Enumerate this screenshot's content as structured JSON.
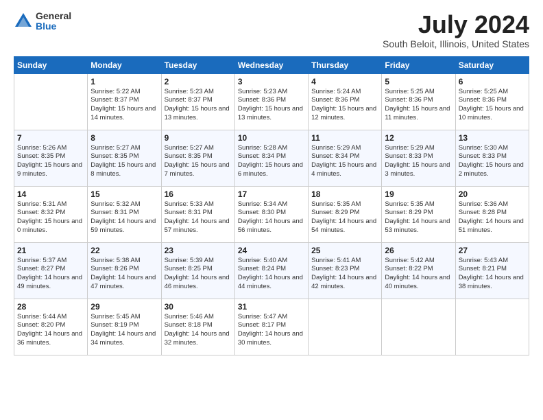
{
  "logo": {
    "general": "General",
    "blue": "Blue"
  },
  "title": "July 2024",
  "subtitle": "South Beloit, Illinois, United States",
  "days_header": [
    "Sunday",
    "Monday",
    "Tuesday",
    "Wednesday",
    "Thursday",
    "Friday",
    "Saturday"
  ],
  "weeks": [
    [
      {
        "num": "",
        "sunrise": "",
        "sunset": "",
        "daylight": ""
      },
      {
        "num": "1",
        "sunrise": "Sunrise: 5:22 AM",
        "sunset": "Sunset: 8:37 PM",
        "daylight": "Daylight: 15 hours and 14 minutes."
      },
      {
        "num": "2",
        "sunrise": "Sunrise: 5:23 AM",
        "sunset": "Sunset: 8:37 PM",
        "daylight": "Daylight: 15 hours and 13 minutes."
      },
      {
        "num": "3",
        "sunrise": "Sunrise: 5:23 AM",
        "sunset": "Sunset: 8:36 PM",
        "daylight": "Daylight: 15 hours and 13 minutes."
      },
      {
        "num": "4",
        "sunrise": "Sunrise: 5:24 AM",
        "sunset": "Sunset: 8:36 PM",
        "daylight": "Daylight: 15 hours and 12 minutes."
      },
      {
        "num": "5",
        "sunrise": "Sunrise: 5:25 AM",
        "sunset": "Sunset: 8:36 PM",
        "daylight": "Daylight: 15 hours and 11 minutes."
      },
      {
        "num": "6",
        "sunrise": "Sunrise: 5:25 AM",
        "sunset": "Sunset: 8:36 PM",
        "daylight": "Daylight: 15 hours and 10 minutes."
      }
    ],
    [
      {
        "num": "7",
        "sunrise": "Sunrise: 5:26 AM",
        "sunset": "Sunset: 8:35 PM",
        "daylight": "Daylight: 15 hours and 9 minutes."
      },
      {
        "num": "8",
        "sunrise": "Sunrise: 5:27 AM",
        "sunset": "Sunset: 8:35 PM",
        "daylight": "Daylight: 15 hours and 8 minutes."
      },
      {
        "num": "9",
        "sunrise": "Sunrise: 5:27 AM",
        "sunset": "Sunset: 8:35 PM",
        "daylight": "Daylight: 15 hours and 7 minutes."
      },
      {
        "num": "10",
        "sunrise": "Sunrise: 5:28 AM",
        "sunset": "Sunset: 8:34 PM",
        "daylight": "Daylight: 15 hours and 6 minutes."
      },
      {
        "num": "11",
        "sunrise": "Sunrise: 5:29 AM",
        "sunset": "Sunset: 8:34 PM",
        "daylight": "Daylight: 15 hours and 4 minutes."
      },
      {
        "num": "12",
        "sunrise": "Sunrise: 5:29 AM",
        "sunset": "Sunset: 8:33 PM",
        "daylight": "Daylight: 15 hours and 3 minutes."
      },
      {
        "num": "13",
        "sunrise": "Sunrise: 5:30 AM",
        "sunset": "Sunset: 8:33 PM",
        "daylight": "Daylight: 15 hours and 2 minutes."
      }
    ],
    [
      {
        "num": "14",
        "sunrise": "Sunrise: 5:31 AM",
        "sunset": "Sunset: 8:32 PM",
        "daylight": "Daylight: 15 hours and 0 minutes."
      },
      {
        "num": "15",
        "sunrise": "Sunrise: 5:32 AM",
        "sunset": "Sunset: 8:31 PM",
        "daylight": "Daylight: 14 hours and 59 minutes."
      },
      {
        "num": "16",
        "sunrise": "Sunrise: 5:33 AM",
        "sunset": "Sunset: 8:31 PM",
        "daylight": "Daylight: 14 hours and 57 minutes."
      },
      {
        "num": "17",
        "sunrise": "Sunrise: 5:34 AM",
        "sunset": "Sunset: 8:30 PM",
        "daylight": "Daylight: 14 hours and 56 minutes."
      },
      {
        "num": "18",
        "sunrise": "Sunrise: 5:35 AM",
        "sunset": "Sunset: 8:29 PM",
        "daylight": "Daylight: 14 hours and 54 minutes."
      },
      {
        "num": "19",
        "sunrise": "Sunrise: 5:35 AM",
        "sunset": "Sunset: 8:29 PM",
        "daylight": "Daylight: 14 hours and 53 minutes."
      },
      {
        "num": "20",
        "sunrise": "Sunrise: 5:36 AM",
        "sunset": "Sunset: 8:28 PM",
        "daylight": "Daylight: 14 hours and 51 minutes."
      }
    ],
    [
      {
        "num": "21",
        "sunrise": "Sunrise: 5:37 AM",
        "sunset": "Sunset: 8:27 PM",
        "daylight": "Daylight: 14 hours and 49 minutes."
      },
      {
        "num": "22",
        "sunrise": "Sunrise: 5:38 AM",
        "sunset": "Sunset: 8:26 PM",
        "daylight": "Daylight: 14 hours and 47 minutes."
      },
      {
        "num": "23",
        "sunrise": "Sunrise: 5:39 AM",
        "sunset": "Sunset: 8:25 PM",
        "daylight": "Daylight: 14 hours and 46 minutes."
      },
      {
        "num": "24",
        "sunrise": "Sunrise: 5:40 AM",
        "sunset": "Sunset: 8:24 PM",
        "daylight": "Daylight: 14 hours and 44 minutes."
      },
      {
        "num": "25",
        "sunrise": "Sunrise: 5:41 AM",
        "sunset": "Sunset: 8:23 PM",
        "daylight": "Daylight: 14 hours and 42 minutes."
      },
      {
        "num": "26",
        "sunrise": "Sunrise: 5:42 AM",
        "sunset": "Sunset: 8:22 PM",
        "daylight": "Daylight: 14 hours and 40 minutes."
      },
      {
        "num": "27",
        "sunrise": "Sunrise: 5:43 AM",
        "sunset": "Sunset: 8:21 PM",
        "daylight": "Daylight: 14 hours and 38 minutes."
      }
    ],
    [
      {
        "num": "28",
        "sunrise": "Sunrise: 5:44 AM",
        "sunset": "Sunset: 8:20 PM",
        "daylight": "Daylight: 14 hours and 36 minutes."
      },
      {
        "num": "29",
        "sunrise": "Sunrise: 5:45 AM",
        "sunset": "Sunset: 8:19 PM",
        "daylight": "Daylight: 14 hours and 34 minutes."
      },
      {
        "num": "30",
        "sunrise": "Sunrise: 5:46 AM",
        "sunset": "Sunset: 8:18 PM",
        "daylight": "Daylight: 14 hours and 32 minutes."
      },
      {
        "num": "31",
        "sunrise": "Sunrise: 5:47 AM",
        "sunset": "Sunset: 8:17 PM",
        "daylight": "Daylight: 14 hours and 30 minutes."
      },
      {
        "num": "",
        "sunrise": "",
        "sunset": "",
        "daylight": ""
      },
      {
        "num": "",
        "sunrise": "",
        "sunset": "",
        "daylight": ""
      },
      {
        "num": "",
        "sunrise": "",
        "sunset": "",
        "daylight": ""
      }
    ]
  ]
}
